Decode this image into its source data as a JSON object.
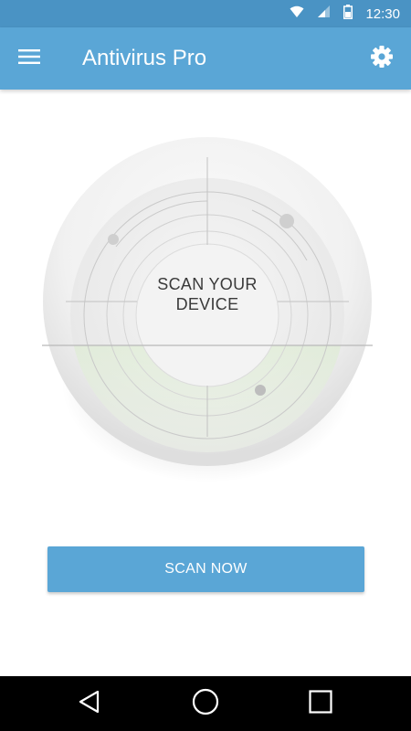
{
  "status_bar": {
    "time": "12:30",
    "icons": [
      "wifi-icon",
      "signal-icon",
      "battery-icon"
    ]
  },
  "app_bar": {
    "title": "Antivirus Pro",
    "menu_icon": "hamburger-menu-icon",
    "settings_icon": "gear-icon"
  },
  "scanner": {
    "label_line1": "SCAN YOUR",
    "label_line2": "DEVICE"
  },
  "scan_button": {
    "label": "SCAN NOW"
  },
  "nav_bar": {
    "icons": [
      "back-icon",
      "home-icon",
      "recents-icon"
    ]
  },
  "colors": {
    "primary": "#5aa6d6",
    "status_bar": "#4a93c4",
    "scan_fill": "#cfe8bf",
    "nav_bar": "#000000"
  }
}
